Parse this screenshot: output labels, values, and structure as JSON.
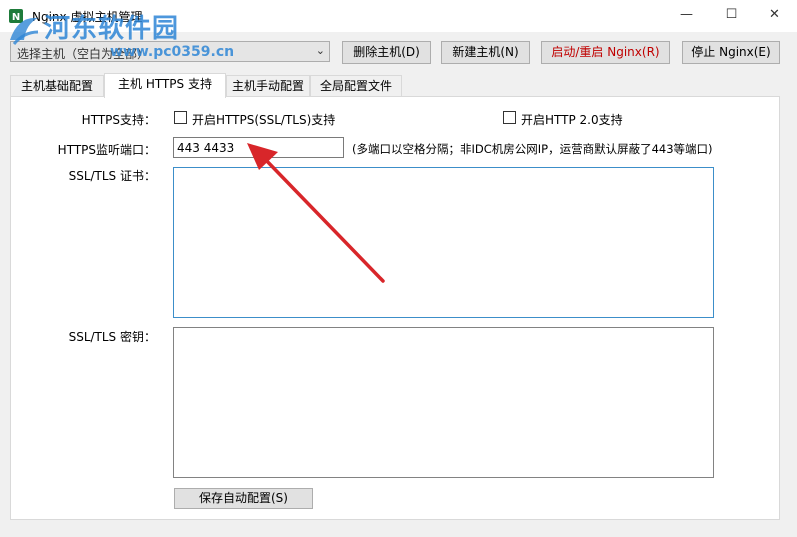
{
  "window": {
    "title": "Nginx 虚拟主机管理",
    "minimize": "—",
    "maximize": "☐",
    "close": "✕"
  },
  "watermark": {
    "text": "河东软件园",
    "url": "www.pc0359.cn"
  },
  "toolbar": {
    "host_select_value": "选择主机（空白为全部）",
    "delete_label": "删除主机(D)",
    "new_label": "新建主机(N)",
    "restart_label": "启动/重启 Nginx(R)",
    "stop_label": "停止 Nginx(E)"
  },
  "tabs": [
    {
      "label": "主机基础配置"
    },
    {
      "label": "主机 HTTPS 支持"
    },
    {
      "label": "主机手动配置"
    },
    {
      "label": "全局配置文件"
    }
  ],
  "form": {
    "https_support_label": "HTTPS支持：",
    "https_enable_label": "开启HTTPS(SSL/TLS)支持",
    "http2_enable_label": "开启HTTP 2.0支持",
    "port_label": "HTTPS监听端口：",
    "port_value": "443 4433",
    "port_hint": "(多端口以空格分隔；非IDC机房公网IP，运营商默认屏蔽了443等端口)",
    "cert_label": "SSL/TLS 证书：",
    "key_label": "SSL/TLS 密钥：",
    "save_label": "保存自动配置(S)"
  },
  "colors": {
    "accent": "#3c8ec9",
    "restart_text": "#c00000",
    "annotation_arrow": "#d8262a",
    "watermark": "#2e86d6"
  }
}
